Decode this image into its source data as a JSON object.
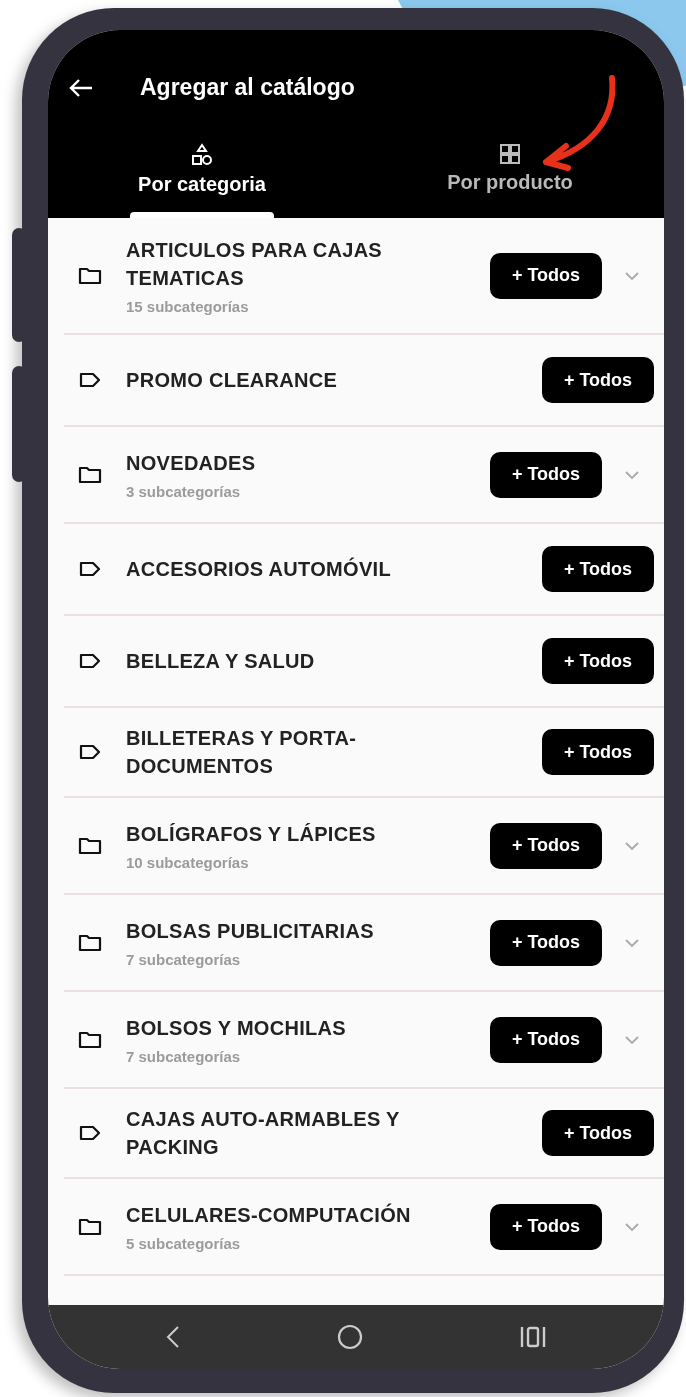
{
  "header": {
    "title": "Agregar al catálogo"
  },
  "tabs": [
    {
      "label": "Por categoria",
      "kind": "shapes",
      "selected": true
    },
    {
      "label": "Por producto",
      "kind": "grid",
      "selected": false
    }
  ],
  "categories": [
    {
      "kind": "folder",
      "name": "ARTICULOS PARA CAJAS TEMATICAS",
      "subcount": "15 subcategorías",
      "button": "+ Todos"
    },
    {
      "kind": "tag",
      "name": "PROMO CLEARANCE",
      "button": "+ Todos"
    },
    {
      "kind": "folder",
      "name": "NOVEDADES",
      "subcount": "3 subcategorías",
      "button": "+ Todos"
    },
    {
      "kind": "tag",
      "name": "ACCESORIOS AUTOMÓVIL",
      "button": "+ Todos"
    },
    {
      "kind": "tag",
      "name": "BELLEZA Y SALUD",
      "button": "+ Todos"
    },
    {
      "kind": "tag",
      "name": "BILLETERAS Y PORTA-DOCUMENTOS",
      "button": "+ Todos"
    },
    {
      "kind": "folder",
      "name": "BOLÍGRAFOS Y LÁPICES",
      "subcount": "10 subcategorías",
      "button": "+ Todos"
    },
    {
      "kind": "folder",
      "name": "BOLSAS PUBLICITARIAS",
      "subcount": "7 subcategorías",
      "button": "+ Todos"
    },
    {
      "kind": "folder",
      "name": "BOLSOS Y MOCHILAS",
      "subcount": "7 subcategorías",
      "button": "+ Todos"
    },
    {
      "kind": "tag",
      "name": "CAJAS AUTO-ARMABLES Y PACKING",
      "button": "+ Todos"
    },
    {
      "kind": "folder",
      "name": "CELULARES-COMPUTACIÓN",
      "subcount": "5 subcategorías",
      "button": "+ Todos"
    }
  ]
}
